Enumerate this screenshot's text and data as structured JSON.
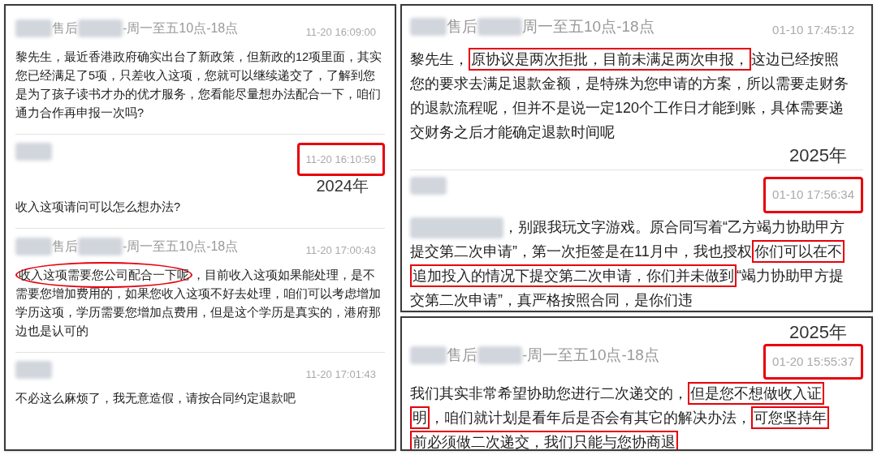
{
  "panels": [
    {
      "messages": [
        {
          "sender": [
            {
              "kind": "blur"
            },
            {
              "kind": "text",
              "text": "售后"
            },
            {
              "kind": "blur"
            },
            {
              "kind": "text",
              "text": "-周一至五10点-18点"
            }
          ],
          "time": "11-20 16:09:00",
          "time_boxed": false,
          "body": [
            {
              "kind": "plain",
              "text": "黎先生，最近香港政府确实出台了新政策，但新政的12项里面，其实您已经满足了5项，只差收入这项，您就可以继续递交了，了解到您是为了孩子读书才办的优才服务，您看能尽量想办法配合一下，咱们通力合作再申报一次吗?"
            }
          ]
        },
        {
          "sender": [
            {
              "kind": "blur"
            }
          ],
          "time": "11-20 16:10:59",
          "time_boxed": true,
          "year_below_time": "2024年",
          "body": [
            {
              "kind": "plain",
              "text": "收入这项请问可以怎么想办法?"
            }
          ]
        },
        {
          "sender": [
            {
              "kind": "blur"
            },
            {
              "kind": "text",
              "text": "售后"
            },
            {
              "kind": "blur"
            },
            {
              "kind": "text",
              "text": "-周一至五10点-18点"
            }
          ],
          "time": "11-20 17:00:43",
          "time_boxed": false,
          "body": [
            {
              "kind": "circled",
              "text": "收入这项需要您公司配合一下呢"
            },
            {
              "kind": "plain",
              "text": "，目前收入这项如果能处理，是不需要您增加费用的，如果您收入这项不好去处理，咱们可以考虑增加学历这项，学历需要您增加点费用，但是这个学历是真实的，港府那边也是认可的"
            }
          ]
        },
        {
          "sender": [
            {
              "kind": "blur"
            }
          ],
          "time": "11-20 17:01:43",
          "time_boxed": false,
          "body": [
            {
              "kind": "plain",
              "text": "不必这么麻烦了，我无意造假，请按合同约定退款吧"
            }
          ]
        }
      ]
    },
    {
      "messages": [
        {
          "sender": [
            {
              "kind": "blur"
            },
            {
              "kind": "text",
              "text": "售后"
            },
            {
              "kind": "blur"
            },
            {
              "kind": "text",
              "text": "周一至五10点-18点"
            }
          ],
          "time": "01-10 17:45:12",
          "time_boxed": false,
          "year_below_text": "2025年",
          "body": [
            {
              "kind": "plain",
              "text": "黎先生，"
            },
            {
              "kind": "boxed",
              "text": "原协议是两次拒批，目前未满足两次申报，"
            },
            {
              "kind": "plain",
              "text": "这边已经按照您的要求去满足退款金额，是特殊为您申请的方案，所以需要走财务的退款流程呢，但并不是说一定120个工作日才能到账，具体需要递交财务之后才能确定退款时间呢"
            }
          ]
        },
        {
          "sender": [
            {
              "kind": "blur"
            }
          ],
          "time": "01-10 17:56:34",
          "time_boxed": true,
          "body": [
            {
              "kind": "blur"
            },
            {
              "kind": "plain",
              "text": "，别跟我玩文字游戏。原合同写着“乙方竭力协助甲方提交第二次申请”，第一次拒签是在11月中，我也授权"
            },
            {
              "kind": "boxed",
              "text": "你们可以在不追加投入的情况下提交第二次申请，你们并未做到"
            },
            {
              "kind": "plain",
              "text": "“竭力协助甲方提交第二次申请”，真严格按照合同，是你们违"
            }
          ]
        }
      ]
    },
    {
      "messages": [
        {
          "sender": [
            {
              "kind": "blur"
            },
            {
              "kind": "text",
              "text": "售后"
            },
            {
              "kind": "blur"
            },
            {
              "kind": "text",
              "text": "-周一至五10点-18点"
            }
          ],
          "time": "01-20 15:55:37",
          "time_boxed": true,
          "year_above_time": "2025年",
          "body": [
            {
              "kind": "plain",
              "text": "我们其实非常希望协助您进行二次递交的，"
            },
            {
              "kind": "boxed",
              "text": "但是您不想做收入证明"
            },
            {
              "kind": "plain",
              "text": "，咱们就计划是看年后是否会有其它的解决办法，"
            },
            {
              "kind": "boxed",
              "text": "可您坚持年前必须做二次递交，我们只能与您协商退"
            }
          ]
        }
      ]
    }
  ]
}
